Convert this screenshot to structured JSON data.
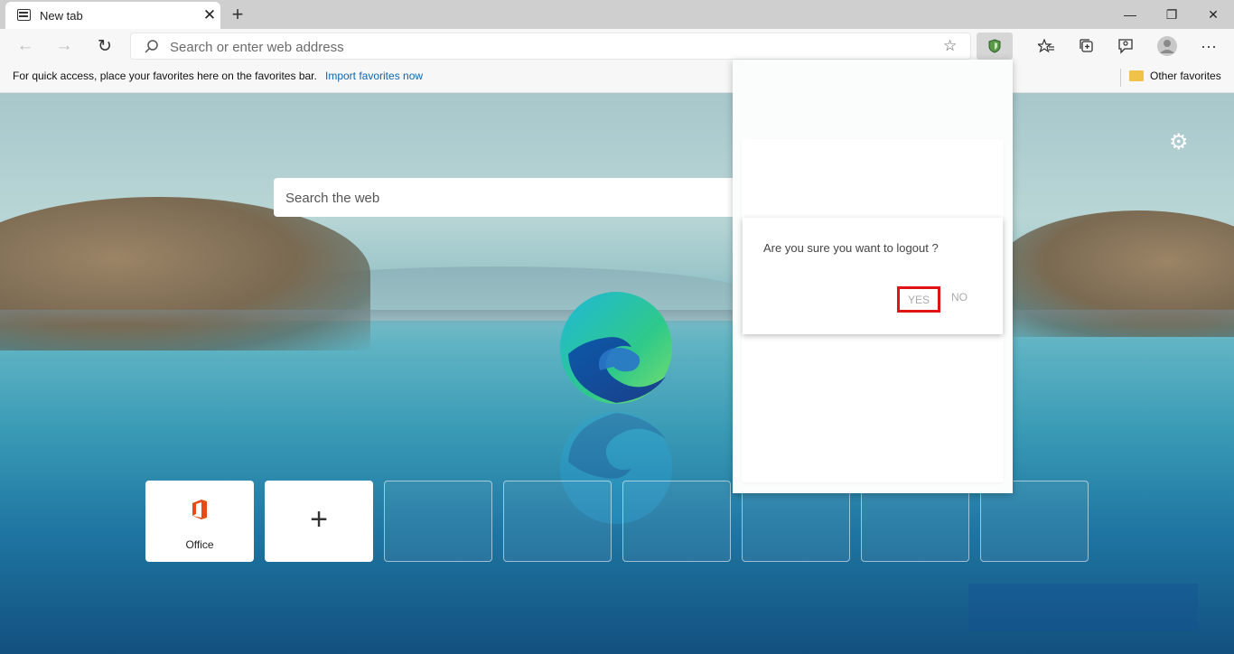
{
  "tab": {
    "title": "New tab",
    "close_glyph": "✕",
    "new_glyph": "+"
  },
  "window": {
    "minimize": "—",
    "restore": "❐",
    "close": "✕"
  },
  "toolbar": {
    "back": "←",
    "forward": "→",
    "refresh": "↻",
    "address_placeholder": "Search or enter web address",
    "star": "☆",
    "icons": [
      "favorites-icon",
      "collections-icon",
      "feedback-icon",
      "profile-icon",
      "more-icon"
    ]
  },
  "favbar": {
    "message": "For quick access, place your favorites here on the favorites bar.",
    "import_link": "Import favorites now",
    "other_favorites": "Other favorites"
  },
  "newtab": {
    "search_placeholder": "Search the web",
    "tiles": [
      {
        "label": "Office"
      },
      {
        "label": ""
      }
    ]
  },
  "dialog": {
    "question": "Are you sure you want to logout ?",
    "yes": "YES",
    "no": "NO"
  },
  "colors": {
    "accent": "#0a66b5",
    "highlight": "#e01414",
    "office": "#e64a19"
  }
}
